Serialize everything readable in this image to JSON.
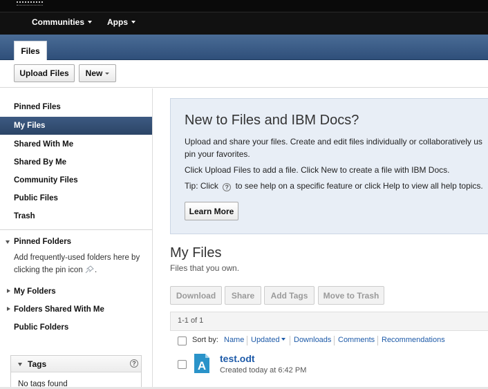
{
  "topnav": {
    "items": [
      {
        "label": "Communities"
      },
      {
        "label": "Apps"
      }
    ]
  },
  "tab": {
    "label": "Files"
  },
  "actions": {
    "upload_label": "Upload Files",
    "new_label": "New"
  },
  "sidebar": {
    "items": [
      {
        "label": "Pinned Files"
      },
      {
        "label": "My Files",
        "selected": true
      },
      {
        "label": "Shared With Me"
      },
      {
        "label": "Shared By Me"
      },
      {
        "label": "Community Files"
      },
      {
        "label": "Public Files"
      },
      {
        "label": "Trash"
      }
    ],
    "pinned_folders": {
      "label": "Pinned Folders",
      "hint": "Add frequently-used folders here by clicking the pin icon",
      "hint_end": "."
    },
    "sections": [
      {
        "label": "My Folders"
      },
      {
        "label": "Folders Shared With Me"
      },
      {
        "label": "Public Folders"
      }
    ],
    "tags": {
      "title": "Tags",
      "help": "?",
      "empty": "No tags found"
    }
  },
  "welcome": {
    "title": "New to Files and IBM Docs?",
    "line1": "Upload and share your files. Create and edit files individually or collaboratively us",
    "line2": "pin your favorites.",
    "line3": "Click Upload Files to add a file. Click New to create a file with IBM Docs.",
    "tip_prefix": "Tip: Click",
    "tip_icon": "?",
    "tip_suffix": "to see help on a specific feature or click Help to view all help topics.",
    "learn_more": "Learn More"
  },
  "main": {
    "title": "My Files",
    "subtitle": "Files that you own.",
    "buttons": {
      "download": "Download",
      "share": "Share",
      "add_tags": "Add Tags",
      "move_to_trash": "Move to Trash"
    },
    "paging": "1-1 of 1",
    "sort": {
      "label": "Sort by:",
      "options": [
        "Name",
        "Updated",
        "Downloads",
        "Comments",
        "Recommendations"
      ]
    },
    "files": [
      {
        "name": "test.odt",
        "meta": "Created today at 6:42 PM",
        "icon_letter": "A"
      }
    ]
  },
  "colors": {
    "accent_blue": "#1d5aa8",
    "selected_bg": "#2b4466",
    "banner": "#3e5f88",
    "welcome_bg": "#e8eef6"
  }
}
